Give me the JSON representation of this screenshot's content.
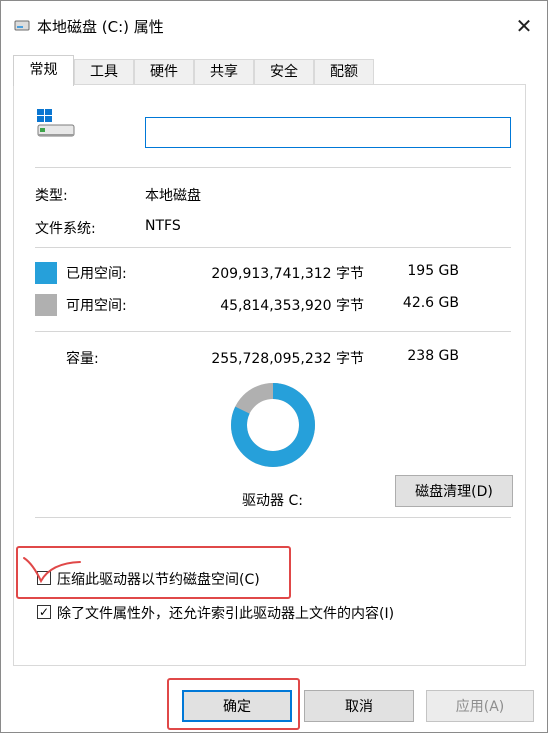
{
  "window": {
    "title": "本地磁盘 (C:) 属性",
    "close_glyph": "✕"
  },
  "tabs": [
    {
      "label": "常规",
      "active": true
    },
    {
      "label": "工具"
    },
    {
      "label": "硬件"
    },
    {
      "label": "共享"
    },
    {
      "label": "安全"
    },
    {
      "label": "配额"
    }
  ],
  "general": {
    "drive_name_value": "",
    "type_label": "类型:",
    "type_value": "本地磁盘",
    "fs_label": "文件系统:",
    "fs_value": "NTFS",
    "used": {
      "label": "已用空间:",
      "bytes": "209,913,741,312 字节",
      "size": "195 GB",
      "color": "#26a0da"
    },
    "free": {
      "label": "可用空间:",
      "bytes": "45,814,353,920 字节",
      "size": "42.6 GB",
      "color": "#b0b0b0"
    },
    "capacity": {
      "label": "容量:",
      "bytes": "255,728,095,232 字节",
      "size": "238 GB"
    },
    "usage_fraction": 0.8209,
    "drive_label": "驱动器 C:",
    "cleanup_button": "磁盘清理(D)",
    "compress_label": "压缩此驱动器以节约磁盘空间(C)",
    "compress_checked": false,
    "index_label": "除了文件属性外，还允许索引此驱动器上文件的内容(I)",
    "index_checked": true
  },
  "buttons": {
    "ok": "确定",
    "cancel": "取消",
    "apply": "应用(A)"
  },
  "annotation_color": "#e04848",
  "icons": [
    "windows-logo-icon",
    "drive-icon",
    "close-icon",
    "checkmark-icon"
  ]
}
